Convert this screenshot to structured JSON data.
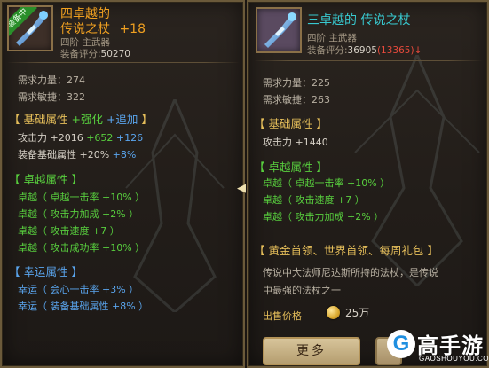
{
  "left": {
    "equipped_tag": "装备中",
    "title_line1": "四卓越的",
    "title_line2": "传说之杖",
    "title_plus": "+18",
    "tier": "四阶 主武器",
    "score_label": "装备评分:",
    "score_value": "50270",
    "req_str": "需求力量：274",
    "req_agi": "需求敏捷：322",
    "base_header_a": "【 基础属性",
    "base_header_b": "+强化",
    "base_header_c": "+追加",
    "base_header_d": "】",
    "atk_label": "攻击力",
    "atk_base": " +2016",
    "atk_enh": " +652",
    "atk_add": " +126",
    "eq_base_label": "装备基础属性",
    "eq_base_val": " +20%",
    "eq_base_add": " +8%",
    "exc_header": "【 卓越属性 】",
    "exc": [
      "卓越（ 卓越一击率 +10% ）",
      "卓越（ 攻击力加成 +2% ）",
      "卓越（ 攻击速度 +7 ）",
      "卓越（ 攻击成功率 +10% ）"
    ],
    "luck_header": "【 幸运属性 】",
    "luck": [
      "幸运（ 会心一击率 +3% ）",
      "幸运（ 装备基础属性 +8% ）"
    ]
  },
  "right": {
    "title": "三卓越的 传说之杖",
    "tier": "四阶 主武器",
    "score_label": "装备评分:",
    "score_value": "36905",
    "score_diff": "(13365)",
    "score_arrow": "↓",
    "req_str": "需求力量：225",
    "req_agi": "需求敏捷：263",
    "base_header": "【 基础属性 】",
    "atk": "攻击力 +1440",
    "exc_header": "【 卓越属性 】",
    "exc": [
      "卓越（ 卓越一击率 +10% ）",
      "卓越（ 攻击速度 +7 ）",
      "卓越（ 攻击力加成 +2% ）"
    ],
    "source_header": "【 黄金首领、世界首领、每周礼包 】",
    "desc_line1": "传说中大法师尼达斯所持的法杖，是传说",
    "desc_line2": "中最强的法杖之一",
    "sell_label": "出售价格",
    "sell_value": "25万",
    "more_button": "更多"
  },
  "compare_arrow": "◀",
  "watermark": {
    "logo_letter": "G",
    "cn": "高手游",
    "en": "GAOSHOUYOU.COM"
  },
  "colors": {
    "gold": "#e5be5a",
    "green": "#58cf3e",
    "blue": "#5aa5ee",
    "cyan": "#38c9d0",
    "red": "#e84a3c"
  },
  "icons": [
    "staff-icon",
    "coin-icon",
    "compare-arrow-icon"
  ]
}
